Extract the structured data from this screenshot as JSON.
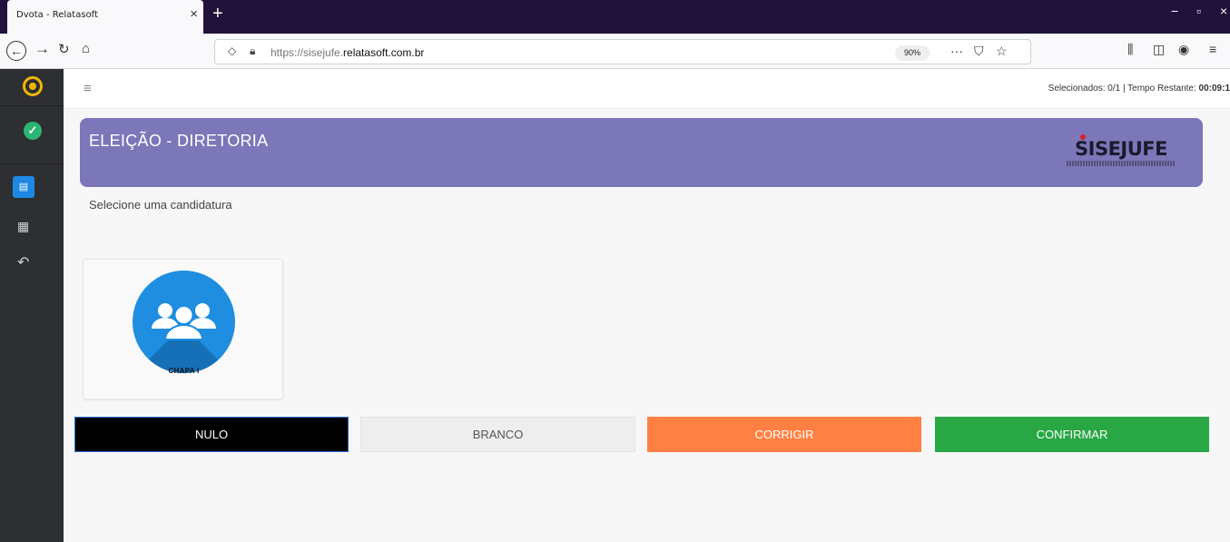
{
  "browser": {
    "tab_title": "Dvota - Relatasoft",
    "tab_close": "×",
    "new_tab": "+",
    "window_controls": [
      "−",
      "▫",
      "×"
    ],
    "url_prefix": "https://sisejufe.",
    "url_domain": "relatasoft.com.br",
    "zoom": "90%",
    "icons": [
      "back-icon",
      "forward-icon",
      "reload-icon",
      "home-icon",
      "shield-icon",
      "lock-icon",
      "more-icon",
      "pocket-icon",
      "bookmark-star-icon",
      "library-icon",
      "sidebar-toggle-icon",
      "account-icon",
      "menu-icon"
    ]
  },
  "sidebar": {
    "icons": [
      "app-logo-icon",
      "check-circle-icon",
      "id-card-icon",
      "qr-code-icon",
      "undo-icon"
    ]
  },
  "header": {
    "menu_icon": "≡",
    "status_prefix": "Selecionados: 0/1 | Tempo Restante: ",
    "time_remaining": "00:09:1"
  },
  "banner": {
    "title": "ELEIÇÃO - DIRETORIA",
    "brand": "SISEJUFE",
    "colors": {
      "background": "#7b77b8"
    }
  },
  "instructions": "Selecione uma candidatura",
  "candidates": [
    {
      "label": "CHAPA I",
      "icon": "group-icon"
    }
  ],
  "actions": {
    "nulo": "NULO",
    "branco": "BRANCO",
    "corrigir": "CORRIGIR",
    "confirmar": "CONFIRMAR"
  },
  "colors": {
    "nulo": "#000000",
    "branco": "#eeeeee",
    "corrigir": "#ff8043",
    "confirmar": "#28a744",
    "sidebar": "#2d2f32",
    "accent": "#1e88e5"
  }
}
